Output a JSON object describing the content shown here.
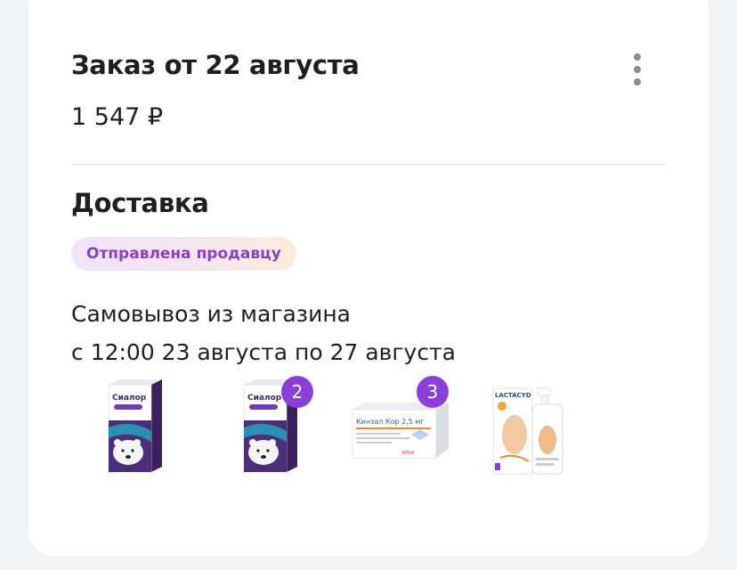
{
  "order": {
    "title": "Заказ от 22 августа",
    "price": "1 547 ₽",
    "menu_icon": "more-vertical-icon"
  },
  "delivery": {
    "title": "Доставка",
    "status": "Отправлена продавцу",
    "method": "Самовывоз из магазина",
    "window": "с 12:00 23 августа по 27 августа"
  },
  "items": [
    {
      "product": "Сиалор",
      "count": null
    },
    {
      "product": "Сиалор",
      "count": "2"
    },
    {
      "product": "Кинзал Кор 2,5 мг",
      "count": "3"
    },
    {
      "product": "LACTACYD",
      "count": null
    }
  ],
  "colors": {
    "accent": "#8a3fd8",
    "status_text": "#8a3fc4",
    "background": "#f2f3f5",
    "card": "#ffffff"
  }
}
